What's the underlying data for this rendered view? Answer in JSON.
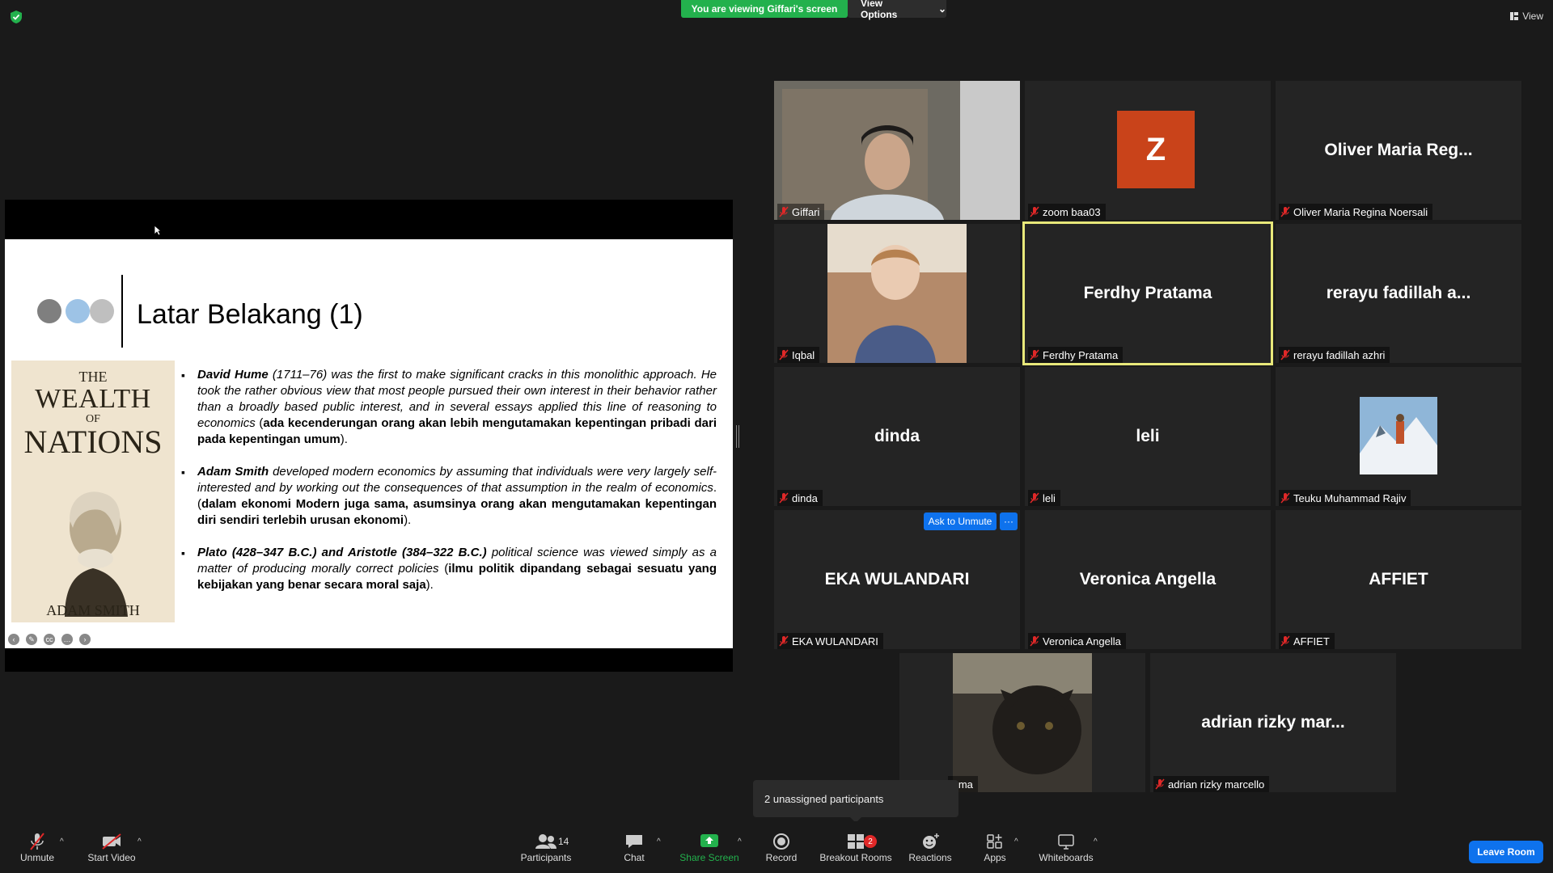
{
  "top": {
    "viewing_banner": "You are viewing Giffari's screen",
    "view_options": "View Options",
    "view_button": "View"
  },
  "slide": {
    "title": "Latar Belakang (1)",
    "book": {
      "the": "THE",
      "wealth": "WEALTH",
      "of": "OF",
      "nations": "NATIONS",
      "author": "ADAM SMITH"
    },
    "bullets": [
      {
        "lead": "David Hume",
        "p1": " (1711–76) was the first to make significant cracks in this monolithic approach. He took the rather obvious view that most people pursued their own interest in their behavior rather than a broadly based public interest, and in several essays applied this line of reasoning to economics",
        "p2": " (",
        "p3": "ada kecenderungan orang akan lebih mengutamakan kepentingan pribadi dari pada kepentingan umum",
        "p4": ")."
      },
      {
        "lead": "Adam Smith",
        "p1": " developed modern economics by assuming that individuals were very largely self-interested and by working out the consequences of that assumption in the realm of economics",
        "p2": ". (",
        "p3": "dalam ekonomi Modern juga sama, asumsinya orang akan mengutamakan kepentingan diri sendiri terlebih urusan ekonomi",
        "p4": ")."
      },
      {
        "lead": "Plato (428–347 B.C.) and Aristotle (384–322 B.C.)",
        "p1": " political science was viewed simply as a matter of producing morally correct policies",
        "p2": " (",
        "p3": "ilmu politik dipandang sebagai sesuatu yang kebijakan yang benar secara moral saja",
        "p4": ")."
      }
    ],
    "dot_colors": [
      "#7f7f7f",
      "#9dc3e6",
      "#bfbfbf"
    ]
  },
  "tiles": [
    {
      "name": "Giffari",
      "big": "",
      "type": "video"
    },
    {
      "name": "zoom baa03",
      "big": "Z",
      "type": "avatar"
    },
    {
      "name": "Oliver Maria Regina Noersali",
      "big": "Oliver Maria Reg...",
      "type": "text"
    },
    {
      "name": "Iqbal",
      "big": "",
      "type": "video"
    },
    {
      "name": "Ferdhy Pratama",
      "big": "Ferdhy Pratama",
      "type": "text"
    },
    {
      "name": "rerayu fadillah azhri",
      "big": "rerayu fadillah a...",
      "type": "text"
    },
    {
      "name": "dinda",
      "big": "dinda",
      "type": "text"
    },
    {
      "name": "leli",
      "big": "leli",
      "type": "text"
    },
    {
      "name": "Teuku Muhammad Rajiv",
      "big": "",
      "type": "photo"
    },
    {
      "name": "EKA WULANDARI",
      "big": "EKA WULANDARI",
      "type": "text"
    },
    {
      "name": "Veronica Angella",
      "big": "Veronica Angella",
      "type": "text"
    },
    {
      "name": "AFFIET",
      "big": "AFFIET",
      "type": "text"
    },
    {
      "name": "mma",
      "big": "",
      "type": "video"
    },
    {
      "name": "adrian rizky marcello",
      "big": "adrian rizky mar...",
      "type": "text"
    }
  ],
  "tile_actions": {
    "ask_to_unmute": "Ask to Unmute",
    "more": "···"
  },
  "toolbar": {
    "unmute": "Unmute",
    "start_video": "Start Video",
    "participants": "Participants",
    "participant_count": "14",
    "chat": "Chat",
    "share_screen": "Share Screen",
    "record": "Record",
    "breakout_rooms": "Breakout Rooms",
    "breakout_badge": "2",
    "reactions": "Reactions",
    "apps": "Apps",
    "whiteboards": "Whiteboards",
    "leave_room": "Leave Room"
  },
  "popup": {
    "unassigned": "2 unassigned participants"
  },
  "colors": {
    "accent": "#0e72ed",
    "green": "#23b14d",
    "active_border": "#e8e87a",
    "avatar_bg": "#c9431a",
    "leave": "#0e72ed"
  }
}
